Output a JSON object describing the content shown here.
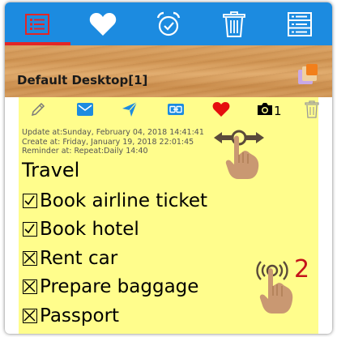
{
  "tabbar": {
    "tabs": [
      {
        "icon": "list-icon",
        "active": true
      },
      {
        "icon": "heart-icon",
        "active": false
      },
      {
        "icon": "alarm-clock-icon",
        "active": false
      },
      {
        "icon": "trash-icon",
        "active": false
      },
      {
        "icon": "server-list-icon",
        "active": false
      }
    ],
    "active_indicator_color": "#e32626",
    "background_color": "#1c8be0"
  },
  "header": {
    "title": "Default Desktop[1]",
    "icon": "stacked-squares-icon"
  },
  "note": {
    "background_color": "#fffd8c",
    "toolbar": {
      "icons": [
        "pencil-icon",
        "mail-icon",
        "send-icon",
        "link-icon",
        "heart-icon",
        "camera-icon",
        "trash-icon"
      ],
      "photo_count": "1"
    },
    "meta": {
      "updated": "Update at:Sunday, February 04, 2018 14:41:41",
      "created": "Create at: Friday, January 19, 2018 22:01:45",
      "reminder": "Reminder at: Repeat:Daily  14:40"
    },
    "title": "Travel",
    "items": [
      {
        "text": "Book airline ticket",
        "checked": true
      },
      {
        "text": "Book hotel",
        "checked": true
      },
      {
        "text": "Rent car",
        "checked": false
      },
      {
        "text": "Prepare baggage",
        "checked": false
      },
      {
        "text": "Passport",
        "checked": false
      }
    ]
  },
  "gestures": {
    "swipe": {
      "icon": "swipe-hand-icon"
    },
    "double_tap": {
      "icon": "tap-hand-icon",
      "count": "2"
    }
  }
}
